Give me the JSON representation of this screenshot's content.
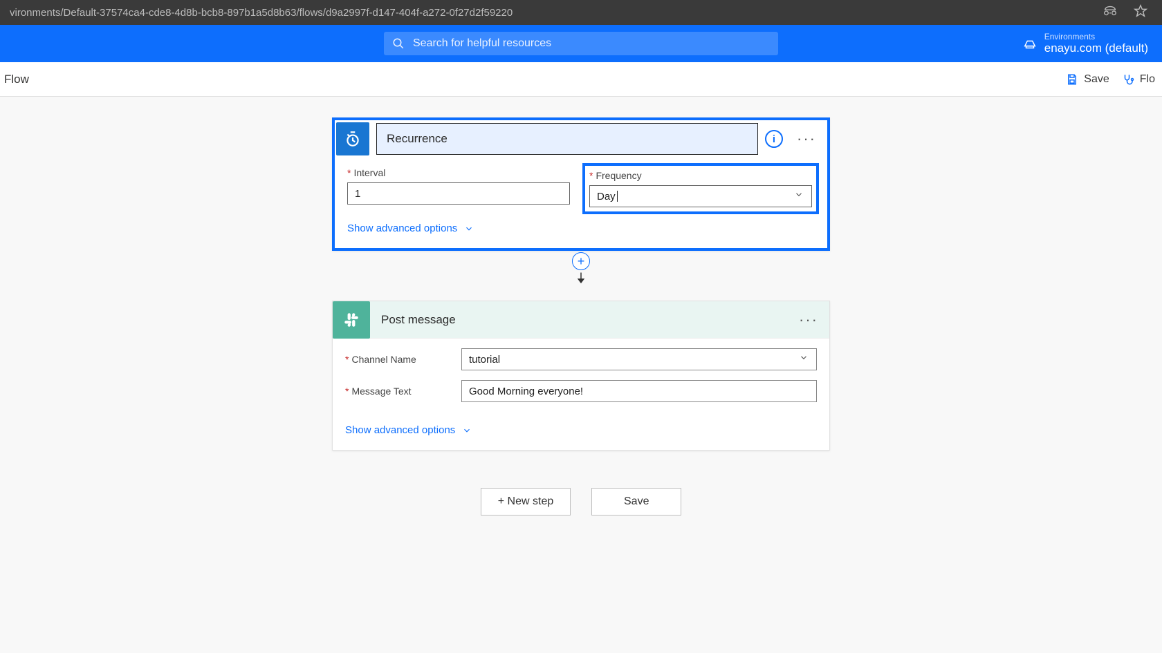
{
  "browser": {
    "url_fragment": "vironments/Default-37574ca4-cde8-4d8b-bcb8-897b1a5d8b63/flows/d9a2997f-d147-404f-a272-0f27d2f59220"
  },
  "header": {
    "search_placeholder": "Search for helpful resources",
    "env_label": "Environments",
    "env_name": "enayu.com (default)"
  },
  "cmdbar": {
    "flow_label": "Flow",
    "save_label": "Save",
    "flowchecker_label": "Flo"
  },
  "trigger": {
    "title": "Recurrence",
    "fields": {
      "interval_label": "Interval",
      "interval_value": "1",
      "frequency_label": "Frequency",
      "frequency_value": "Day"
    },
    "advanced_link": "Show advanced options"
  },
  "action": {
    "title": "Post message",
    "fields": {
      "channel_label": "Channel Name",
      "channel_value": "tutorial",
      "message_label": "Message Text",
      "message_value": "Good Morning everyone!"
    },
    "advanced_link": "Show advanced options"
  },
  "footer": {
    "new_step": "+ New step",
    "save": "Save"
  }
}
